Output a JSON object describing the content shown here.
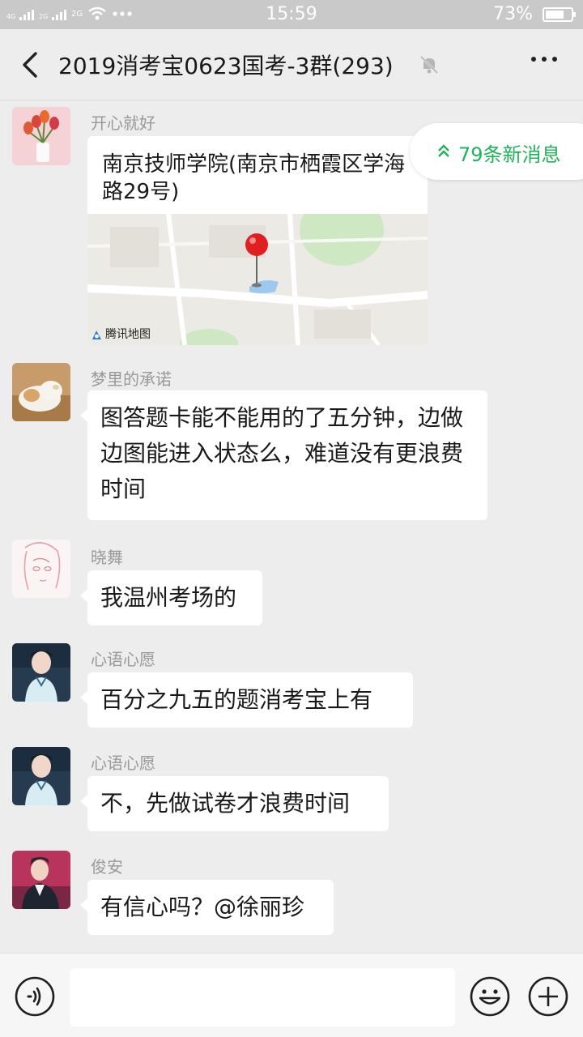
{
  "status_bar": {
    "network_tags": [
      "4G",
      "2G"
    ],
    "network_tag_2": "2G",
    "time": "15:59",
    "battery": "73%",
    "battery_level": 0.73
  },
  "header": {
    "title": "2019消考宝0623国考-3群(293)",
    "icons": [
      "back-icon",
      "mute-icon",
      "more-icon"
    ]
  },
  "new_messages_pill": {
    "label": "79条新消息",
    "accent_color": "#21b35a"
  },
  "messages": [
    {
      "sender": "开心就好",
      "type": "location",
      "location_title": "南京技师学院(南京市栖霞区学海路29号)",
      "map_provider": "腾讯地图"
    },
    {
      "sender": "梦里的承诺",
      "type": "text",
      "text": "图答题卡能不能用的了五分钟，边做边图能进入状态么，难道没有更浪费时间"
    },
    {
      "sender": "晓舞",
      "type": "text",
      "text": "我温州考场的"
    },
    {
      "sender": "心语心愿",
      "type": "text",
      "text": "百分之九五的题消考宝上有"
    },
    {
      "sender": "心语心愿",
      "type": "text",
      "text": "不，先做试卷才浪费时间"
    },
    {
      "sender": "俊安",
      "type": "text",
      "text": "有信心吗？@徐丽珍"
    }
  ],
  "input_bar": {
    "placeholder": "",
    "icons": [
      "voice-icon",
      "emoji-icon",
      "plus-icon"
    ]
  },
  "colors": {
    "background": "#ededed",
    "bubble": "#ffffff",
    "status_bar": "#c9c9c9",
    "map_pin": "#e02020"
  }
}
